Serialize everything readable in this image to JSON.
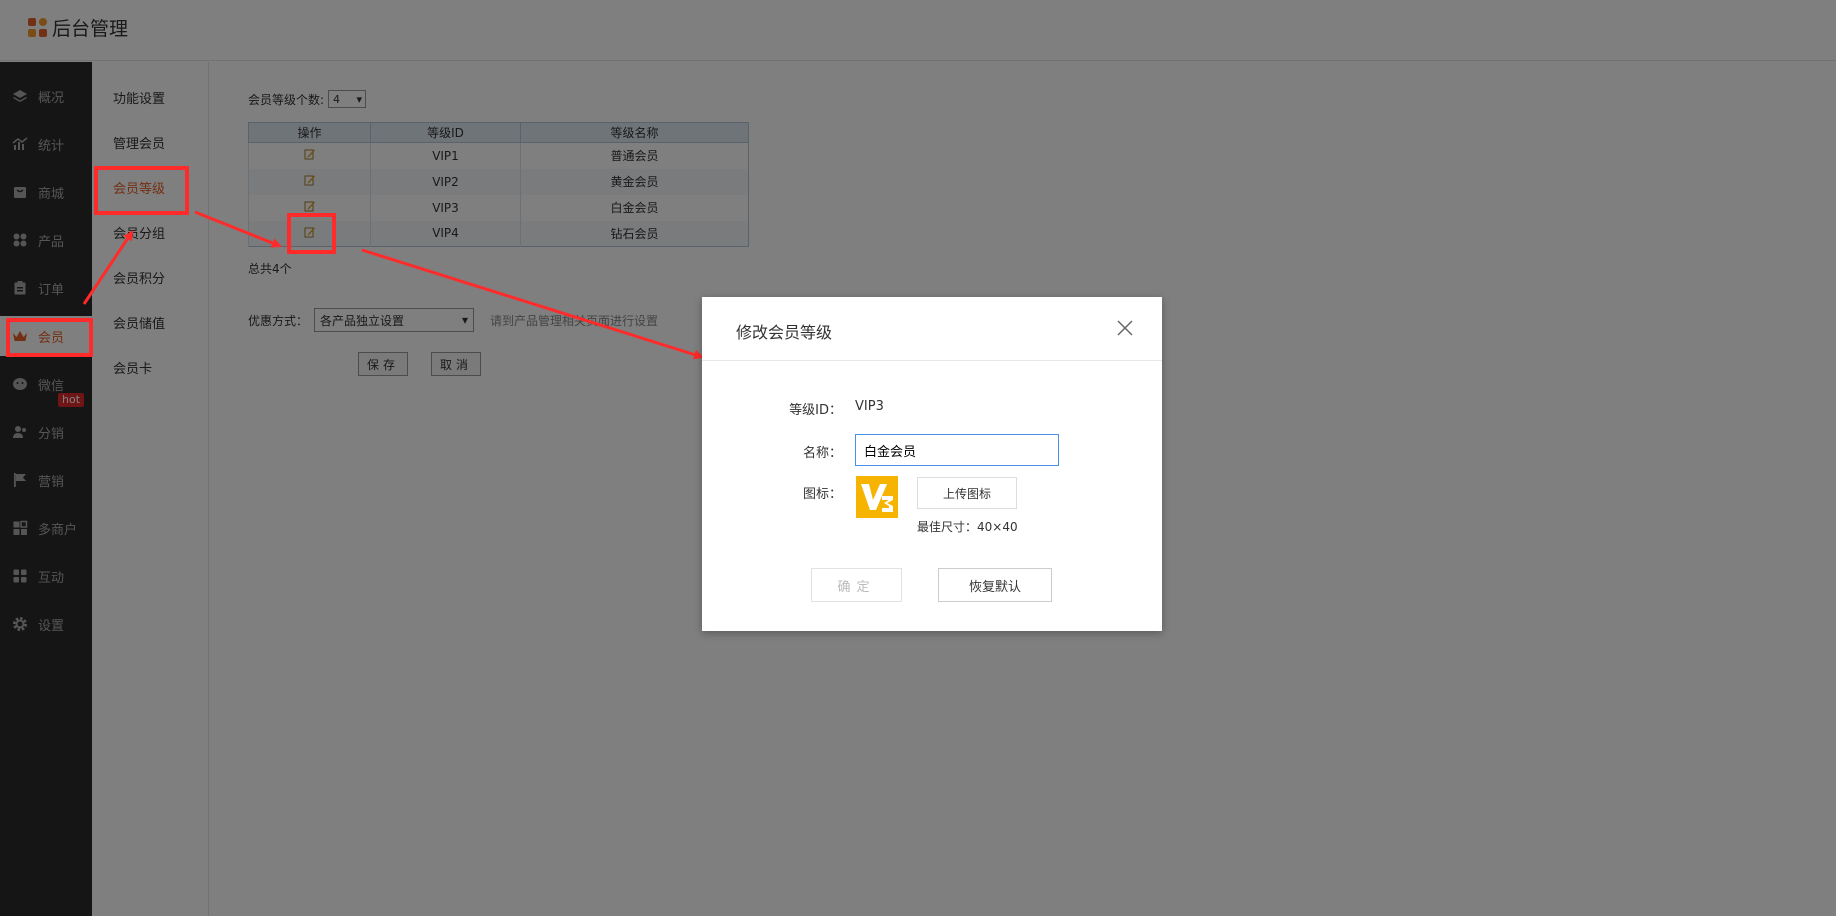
{
  "header": {
    "title": "后台管理"
  },
  "sidebar": {
    "items": [
      {
        "label": "概况",
        "icon": "layers-icon"
      },
      {
        "label": "统计",
        "icon": "chart-icon"
      },
      {
        "label": "商城",
        "icon": "store-icon"
      },
      {
        "label": "产品",
        "icon": "grid-icon"
      },
      {
        "label": "订单",
        "icon": "clipboard-icon"
      },
      {
        "label": "会员",
        "icon": "crown-icon"
      },
      {
        "label": "微信",
        "icon": "wechat-icon"
      },
      {
        "label": "分销",
        "icon": "users-icon"
      },
      {
        "label": "营销",
        "icon": "flag-icon"
      },
      {
        "label": "多商户",
        "icon": "shop-icon"
      },
      {
        "label": "互动",
        "icon": "apps-icon"
      },
      {
        "label": "设置",
        "icon": "gear-icon"
      }
    ],
    "hot_badge": "hot",
    "active_color": "#e5622a"
  },
  "subnav": {
    "items": [
      "功能设置",
      "管理会员",
      "会员等级",
      "会员分组",
      "会员积分",
      "会员储值",
      "会员卡"
    ]
  },
  "main": {
    "level_count_label": "会员等级个数:",
    "level_count_value": "4",
    "table": {
      "headers": [
        "操作",
        "等级ID",
        "等级名称"
      ],
      "rows": [
        {
          "id": "VIP1",
          "name": "普通会员"
        },
        {
          "id": "VIP2",
          "name": "黄金会员"
        },
        {
          "id": "VIP3",
          "name": "白金会员"
        },
        {
          "id": "VIP4",
          "name": "钻石会员"
        }
      ]
    },
    "total": "总共4个",
    "discount_label": "优惠方式：",
    "discount_value": "各产品独立设置",
    "discount_hint": "请到产品管理相关页面进行设置",
    "save_label": "保存",
    "cancel_label": "取消"
  },
  "modal": {
    "title": "修改会员等级",
    "id_label": "等级ID：",
    "id_value": "VIP3",
    "name_label": "名称：",
    "name_value": "白金会员",
    "icon_label": "图标：",
    "upload_label": "上传图标",
    "size_hint": "最佳尺寸：40×40",
    "confirm_label": "确定",
    "reset_label": "恢复默认"
  }
}
